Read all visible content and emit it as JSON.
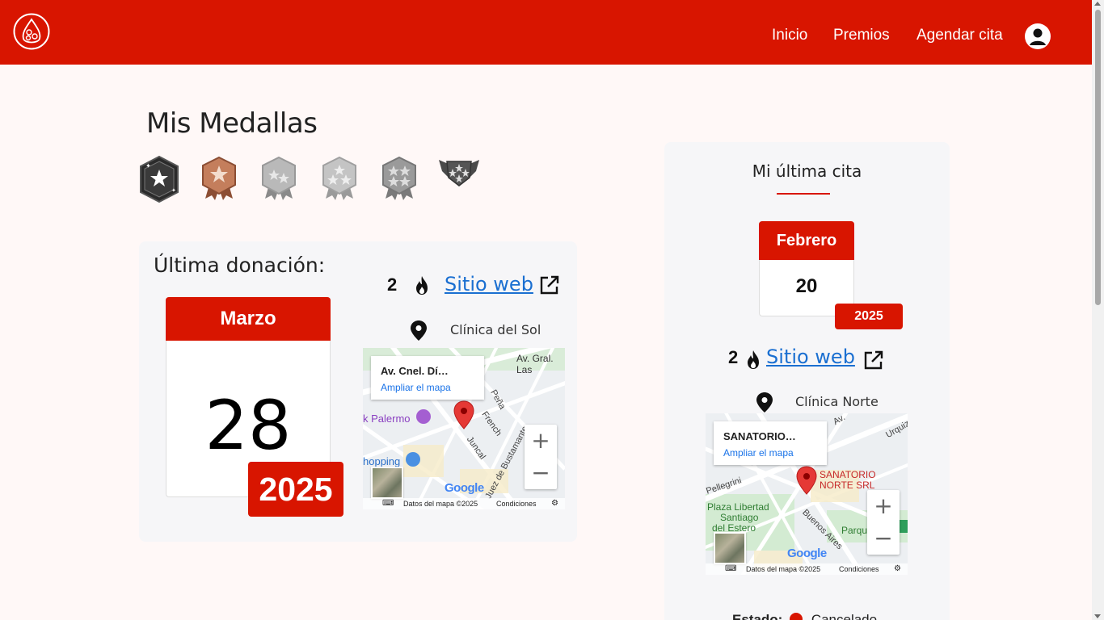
{
  "nav": {
    "home": "Inicio",
    "rewards": "Premios",
    "schedule": "Agendar cita"
  },
  "page": {
    "title": "Mis Medallas",
    "medals": [
      {
        "name": "black-star-medal",
        "color": "#2b2b2b"
      },
      {
        "name": "bronze-star-medal",
        "color": "#b4704f"
      },
      {
        "name": "silver-two-star-medal",
        "color": "#a9a9a9"
      },
      {
        "name": "silver-three-star-medal",
        "color": "#b2b2b2"
      },
      {
        "name": "silver-four-star-medal",
        "color": "#8f8f8f"
      },
      {
        "name": "winged-star-medal",
        "color": "#555555"
      }
    ]
  },
  "last_donation": {
    "title": "Última donación:",
    "month": "Marzo",
    "day": "28",
    "year": "2025",
    "count": "2",
    "site_link": "Sitio web",
    "place": "Clínica del Sol",
    "map": {
      "popup_title": "Av. Cnel. Dí…",
      "popup_link": "Ampliar el mapa",
      "labels": [
        "Av. Gral. Las",
        "Peña",
        "French",
        "Juncal",
        "Juez de Bustamante",
        "k Palermo",
        "hopping"
      ],
      "footer": "Datos del mapa ©2025",
      "terms": "Condiciones",
      "google": "Google"
    }
  },
  "last_appointment": {
    "title": "Mi última cita",
    "month": "Febrero",
    "day": "20",
    "year": "2025",
    "count": "2",
    "site_link": "Sitio web",
    "place": "Clínica Norte",
    "status_label": "Estado:",
    "status_value": "Cancelado",
    "status_color": "#d81500",
    "map": {
      "popup_title": "SANATORIO…",
      "popup_link": "Ampliar el mapa",
      "labels": [
        "SANATORIO",
        "NORTE SRL",
        "Plaza Libertad",
        "Santiago",
        "del Estero",
        "Pellegrini",
        "Buenos Aires",
        "Parque Ag",
        "Av.",
        "Urquiz"
      ],
      "footer": "Datos del mapa ©2025",
      "terms": "Condiciones",
      "google": "Google"
    }
  },
  "colors": {
    "brand": "#d81500",
    "link": "#1a6fd1",
    "background": "#fff8f7"
  }
}
